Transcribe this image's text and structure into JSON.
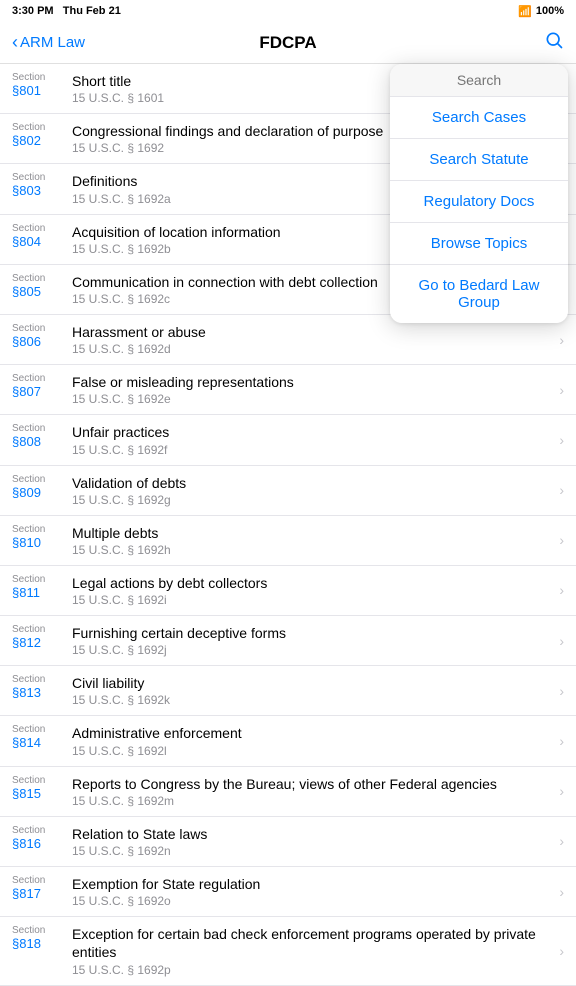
{
  "status_bar": {
    "time": "3:30 PM",
    "day": "Thu Feb 21",
    "wifi": "WiFi",
    "battery": "100%"
  },
  "nav": {
    "back_label": "ARM Law",
    "title": "FDCPA",
    "search_icon": "🔍"
  },
  "sections": [
    {
      "label": "Section",
      "number": "§801",
      "name": "Short title",
      "usc": "15 U.S.C. § 1601",
      "has_chevron": false
    },
    {
      "label": "Section",
      "number": "§802",
      "name": "Congressional findings and declaration of purpose",
      "usc": "15 U.S.C. § 1692",
      "has_chevron": false
    },
    {
      "label": "Section",
      "number": "§803",
      "name": "Definitions",
      "usc": "15 U.S.C. § 1692a",
      "has_chevron": false
    },
    {
      "label": "Section",
      "number": "§804",
      "name": "Acquisition of location information",
      "usc": "15 U.S.C. § 1692b",
      "has_chevron": false
    },
    {
      "label": "Section",
      "number": "§805",
      "name": "Communication in connection with debt collection",
      "usc": "15 U.S.C. § 1692c",
      "has_chevron": false
    },
    {
      "label": "Section",
      "number": "§806",
      "name": "Harassment or abuse",
      "usc": "15 U.S.C. § 1692d",
      "has_chevron": true
    },
    {
      "label": "Section",
      "number": "§807",
      "name": "False or misleading representations",
      "usc": "15 U.S.C. § 1692e",
      "has_chevron": true
    },
    {
      "label": "Section",
      "number": "§808",
      "name": "Unfair practices",
      "usc": "15 U.S.C. § 1692f",
      "has_chevron": true
    },
    {
      "label": "Section",
      "number": "§809",
      "name": "Validation of debts",
      "usc": "15 U.S.C. § 1692g",
      "has_chevron": true
    },
    {
      "label": "Section",
      "number": "§810",
      "name": "Multiple debts",
      "usc": "15 U.S.C. § 1692h",
      "has_chevron": true
    },
    {
      "label": "Section",
      "number": "§811",
      "name": "Legal actions by debt collectors",
      "usc": "15 U.S.C. § 1692i",
      "has_chevron": true
    },
    {
      "label": "Section",
      "number": "§812",
      "name": "Furnishing certain deceptive forms",
      "usc": "15 U.S.C. § 1692j",
      "has_chevron": true
    },
    {
      "label": "Section",
      "number": "§813",
      "name": "Civil liability",
      "usc": "15 U.S.C. § 1692k",
      "has_chevron": true
    },
    {
      "label": "Section",
      "number": "§814",
      "name": "Administrative enforcement",
      "usc": "15 U.S.C. § 1692l",
      "has_chevron": true
    },
    {
      "label": "Section",
      "number": "§815",
      "name": "Reports to Congress by the Bureau; views of other Federal agencies",
      "usc": "15 U.S.C. § 1692m",
      "has_chevron": true
    },
    {
      "label": "Section",
      "number": "§816",
      "name": "Relation to State laws",
      "usc": "15 U.S.C. § 1692n",
      "has_chevron": true
    },
    {
      "label": "Section",
      "number": "§817",
      "name": "Exemption for State regulation",
      "usc": "15 U.S.C. § 1692o",
      "has_chevron": true
    },
    {
      "label": "Section",
      "number": "§818",
      "name": "Exception for certain bad check enforcement programs operated by private entities",
      "usc": "15 U.S.C. § 1692p",
      "has_chevron": true
    }
  ],
  "dropdown": {
    "search_placeholder": "Search",
    "items": [
      {
        "id": "search-cases",
        "label": "Search Cases"
      },
      {
        "id": "search-statute",
        "label": "Search Statute"
      },
      {
        "id": "regulatory-docs",
        "label": "Regulatory Docs"
      },
      {
        "id": "browse-topics",
        "label": "Browse Topics"
      },
      {
        "id": "bedard-law",
        "label": "Go to Bedard Law Group"
      }
    ]
  }
}
